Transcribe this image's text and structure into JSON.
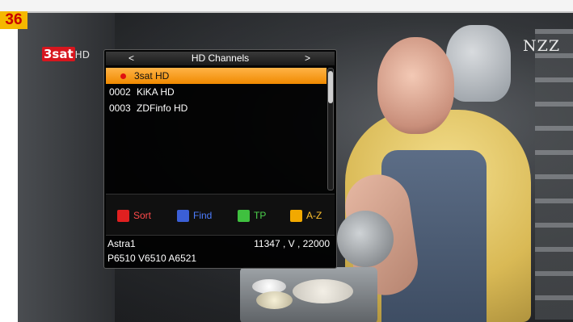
{
  "badge": {
    "channel_number": "36"
  },
  "video": {
    "channel_logo": {
      "number": "3sat",
      "suffix": "HD"
    },
    "watermark": "NZZ"
  },
  "osd": {
    "header": {
      "title": "HD Channels",
      "prev_arrow": "<",
      "next_arrow": ">"
    },
    "channels": [
      {
        "number": "",
        "name": "3sat HD",
        "selected": true,
        "playing": true
      },
      {
        "number": "0002",
        "name": "KiKA HD",
        "selected": false,
        "playing": false
      },
      {
        "number": "0003",
        "name": "ZDFinfo HD",
        "selected": false,
        "playing": false
      }
    ],
    "color_keys": [
      {
        "color": "red",
        "label": "Sort"
      },
      {
        "color": "blue",
        "label": "Find"
      },
      {
        "color": "green",
        "label": "TP"
      },
      {
        "color": "yellow",
        "label": "A-Z"
      }
    ],
    "info": {
      "satellite": "Astra1",
      "transponder": "11347 , V , 22000",
      "pids": "P6510  V6510  A6521"
    }
  },
  "colors": {
    "selection": "#f08a00",
    "badge_bg": "#f5b800",
    "badge_text": "#c80000"
  }
}
